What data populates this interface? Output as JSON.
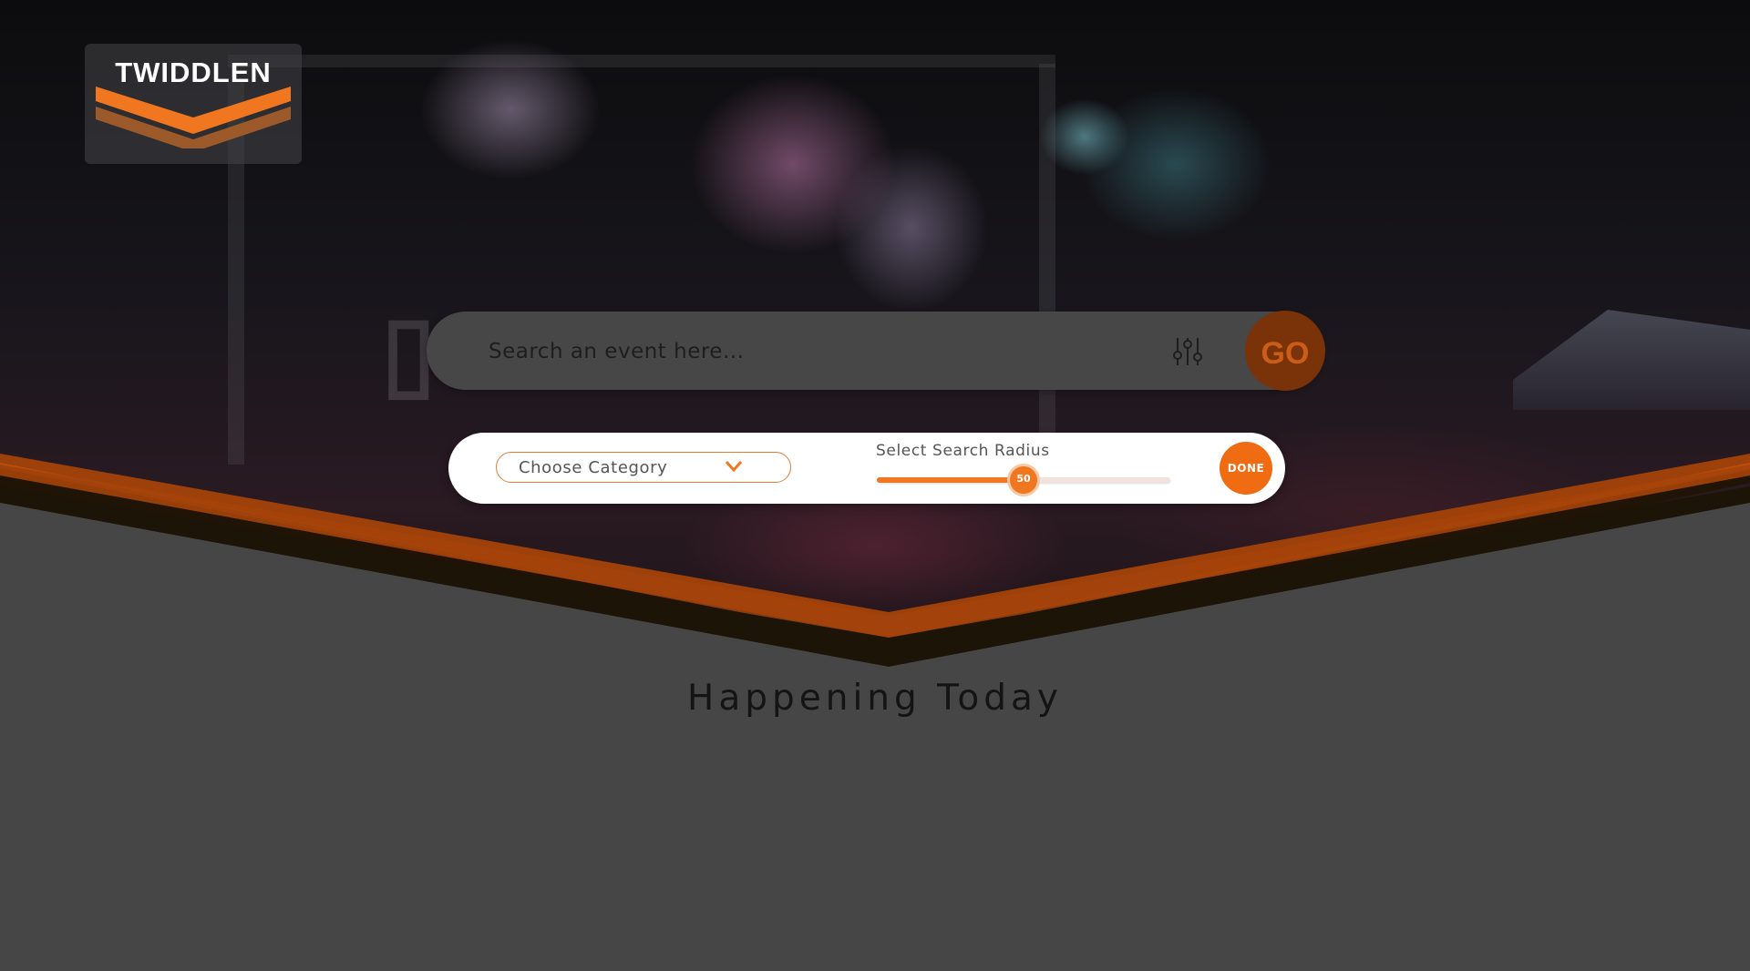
{
  "brand": {
    "name": "TWIDDLEN"
  },
  "colors": {
    "accent": "#f07620",
    "accent_dark": "#7a3308",
    "background": "#464646",
    "panel": "#ffffff"
  },
  "search": {
    "placeholder": "Search an event here...",
    "value": "",
    "filter_icon": "sliders-icon",
    "go_label": "GO"
  },
  "filters": {
    "category_label": "Choose Category",
    "category_icon": "chevron-down-icon",
    "radius_label": "Select Search Radius",
    "radius_value": 50,
    "radius_display": "50",
    "radius_fraction": 0.5,
    "done_label": "DONE"
  },
  "main": {
    "section_title": "Happening Today"
  }
}
